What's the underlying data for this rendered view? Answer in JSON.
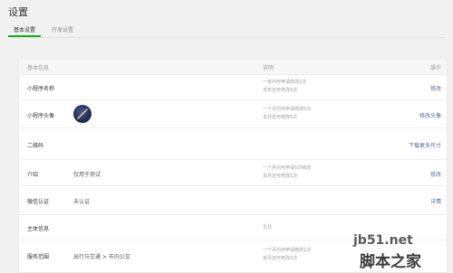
{
  "page": {
    "title": "设置"
  },
  "tabs": [
    {
      "label": "基本设置",
      "active": true
    },
    {
      "label": "开发设置",
      "active": false
    }
  ],
  "table": {
    "headers": {
      "info": "基本信息",
      "desc": "说明",
      "action": "操作"
    },
    "rows": [
      {
        "label": "小程序名称",
        "value": "",
        "desc": [
          "一年内可申请修改1次",
          "本年还可修改1次"
        ],
        "action": "修改"
      },
      {
        "label": "小程序头像",
        "value": "",
        "desc": [
          "一个月内可申请修改5次",
          "本月还可修改5次"
        ],
        "action": "修改头像"
      },
      {
        "label": "二维码",
        "value": "",
        "desc": [],
        "action": "下载更多尺寸"
      },
      {
        "label": "介绍",
        "value": "仅用于测试",
        "desc": [
          "一个月内可申请5次修改",
          "本月还可修改5次"
        ],
        "action": "修改"
      },
      {
        "label": "微信认证",
        "value": "未认证",
        "desc": [],
        "action": "详情"
      },
      {
        "label": "主体信息",
        "value": "",
        "desc": [
          "企业"
        ],
        "action": ""
      },
      {
        "label": "服务范围",
        "value": "出行与交通 > 市内公交",
        "desc": [
          "一个月内可申请修改1次",
          "本月还可修改1次"
        ],
        "action": ""
      }
    ]
  },
  "watermark": {
    "line1": "jb51.net",
    "line2": "脚本之家"
  },
  "colors": {
    "accent": "#1aad19",
    "link": "#576b95"
  }
}
